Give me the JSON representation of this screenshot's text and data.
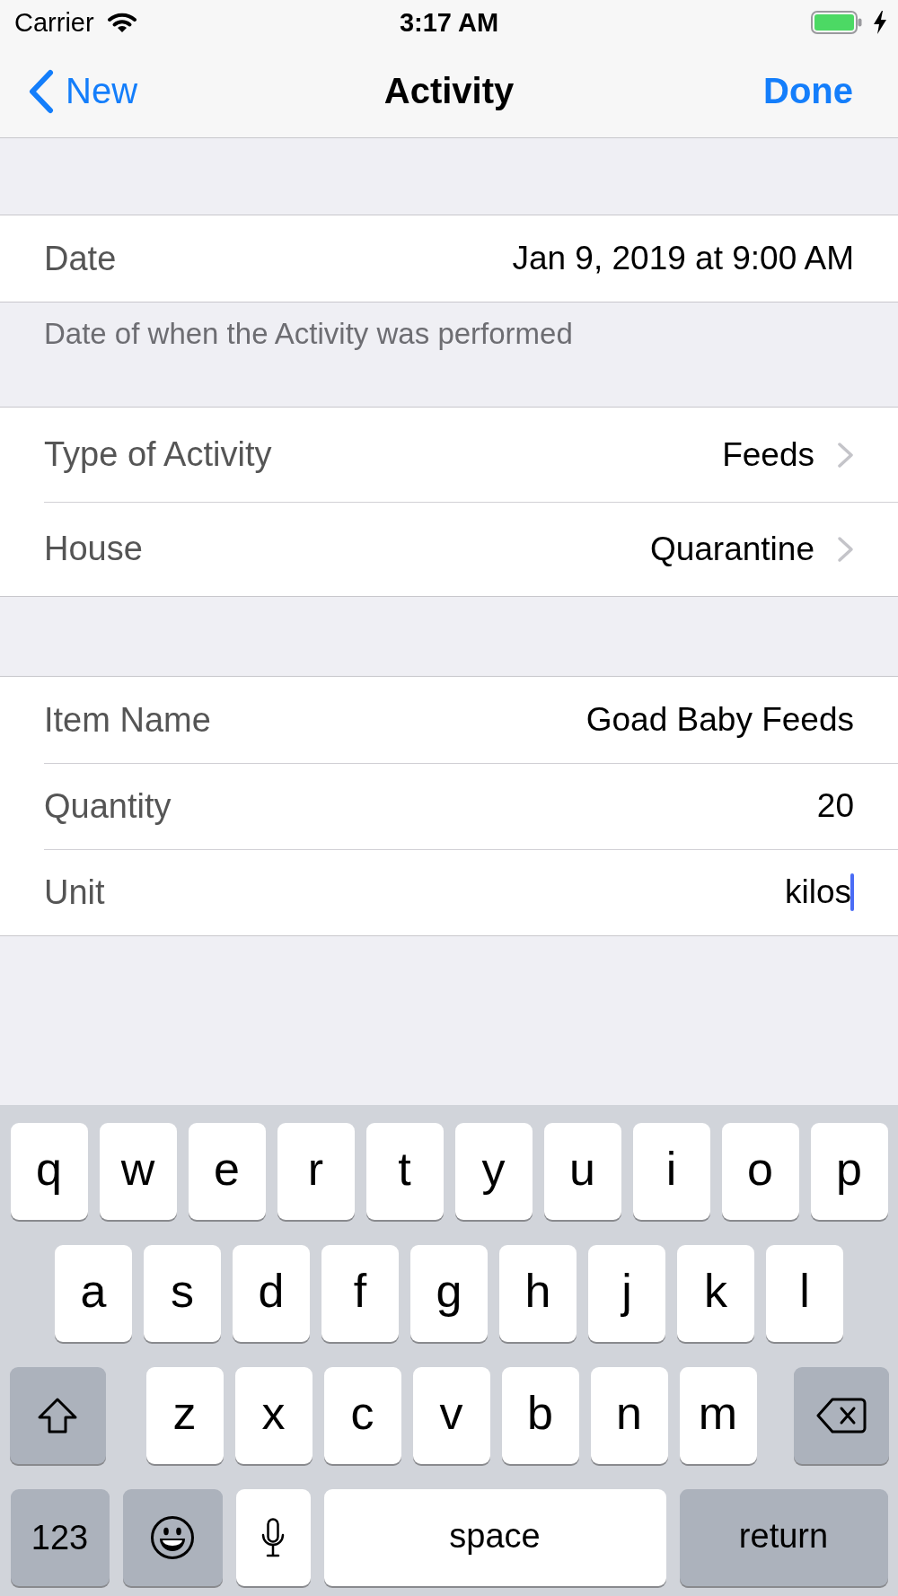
{
  "status_bar": {
    "carrier": "Carrier",
    "time": "3:17 AM"
  },
  "nav_bar": {
    "back": "New",
    "title": "Activity",
    "done": "Done"
  },
  "sections": [
    {
      "rows": [
        {
          "kind": "detail",
          "label": "Date",
          "value": "Jan 9, 2019 at 9:00 AM"
        }
      ],
      "footer": "Date of when the Activity was performed"
    },
    {
      "rows": [
        {
          "kind": "disclosure",
          "label": "Type of Activity",
          "value": "Feeds"
        },
        {
          "kind": "disclosure",
          "label": "House",
          "value": "Quarantine"
        }
      ]
    },
    {
      "rows": [
        {
          "kind": "text_field",
          "label": "Item Name",
          "value": "Goad Baby Feeds",
          "focused": false
        },
        {
          "kind": "text_field",
          "label": "Quantity",
          "value": "20",
          "focused": false
        },
        {
          "kind": "text_field",
          "label": "Unit",
          "value": "kilos",
          "focused": true
        }
      ]
    }
  ],
  "keyboard": {
    "key_rows": [
      {
        "keys": [
          {
            "kind": "letter",
            "label": "q"
          },
          {
            "kind": "letter",
            "label": "w"
          },
          {
            "kind": "letter",
            "label": "e"
          },
          {
            "kind": "letter",
            "label": "r"
          },
          {
            "kind": "letter",
            "label": "t"
          },
          {
            "kind": "letter",
            "label": "y"
          },
          {
            "kind": "letter",
            "label": "u"
          },
          {
            "kind": "letter",
            "label": "i"
          },
          {
            "kind": "letter",
            "label": "o"
          },
          {
            "kind": "letter",
            "label": "p"
          }
        ]
      },
      {
        "keys": [
          {
            "kind": "letter",
            "label": "a"
          },
          {
            "kind": "letter",
            "label": "s"
          },
          {
            "kind": "letter",
            "label": "d"
          },
          {
            "kind": "letter",
            "label": "f"
          },
          {
            "kind": "letter",
            "label": "g"
          },
          {
            "kind": "letter",
            "label": "h"
          },
          {
            "kind": "letter",
            "label": "j"
          },
          {
            "kind": "letter",
            "label": "k"
          },
          {
            "kind": "letter",
            "label": "l"
          }
        ]
      },
      {
        "keys": [
          {
            "kind": "shift",
            "on": false
          },
          {
            "kind": "letter",
            "label": "z"
          },
          {
            "kind": "letter",
            "label": "x"
          },
          {
            "kind": "letter",
            "label": "c"
          },
          {
            "kind": "letter",
            "label": "v"
          },
          {
            "kind": "letter",
            "label": "b"
          },
          {
            "kind": "letter",
            "label": "n"
          },
          {
            "kind": "letter",
            "label": "m"
          },
          {
            "kind": "delete"
          }
        ]
      },
      {
        "keys": [
          {
            "kind": "numbers",
            "label": "123"
          },
          {
            "kind": "emoji"
          },
          {
            "kind": "dictation"
          },
          {
            "kind": "space",
            "label": "space"
          },
          {
            "kind": "return",
            "label": "return"
          }
        ]
      }
    ]
  }
}
